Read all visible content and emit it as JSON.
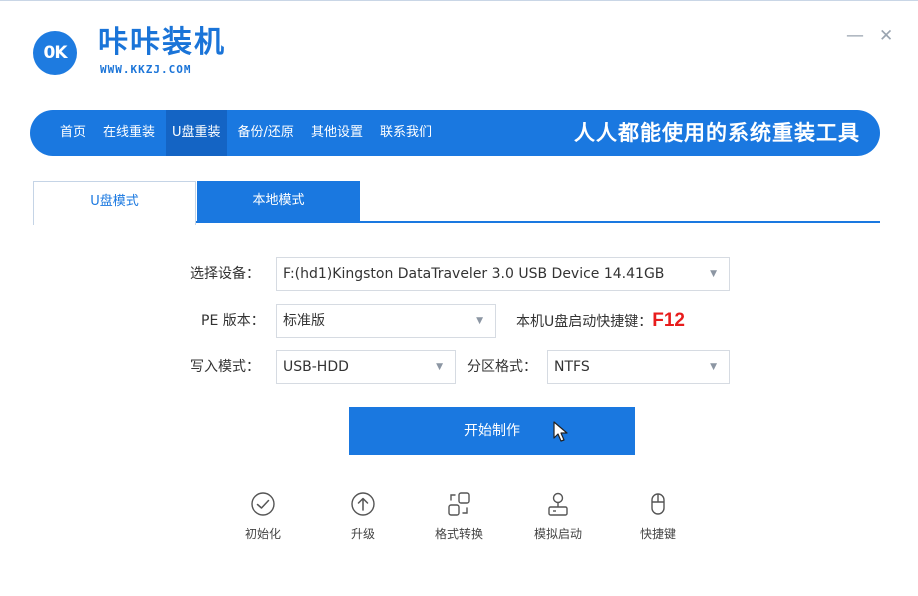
{
  "app": {
    "logo_badge": "0K",
    "title": "咔咔装机",
    "url": "WWW.KKZJ.COM",
    "minimize": "—",
    "close": "✕"
  },
  "nav": {
    "items": [
      {
        "label": "首页"
      },
      {
        "label": "在线重装"
      },
      {
        "label": "U盘重装"
      },
      {
        "label": "备份/还原"
      },
      {
        "label": "其他设置"
      },
      {
        "label": "联系我们"
      }
    ],
    "active_index": 2,
    "slogan": "人人都能使用的系统重装工具"
  },
  "tabs": [
    {
      "label": "U盘模式"
    },
    {
      "label": "本地模式"
    }
  ],
  "form": {
    "device_label": "选择设备：",
    "device_value": "F:(hd1)Kingston DataTraveler 3.0 USB Device 14.41GB",
    "pe_label": "PE 版本：",
    "pe_value": "标准版",
    "hotkey_label": "本机U盘启动快捷键：",
    "hotkey_value": "F12",
    "write_label": "写入模式：",
    "write_value": "USB-HDD",
    "partition_label": "分区格式：",
    "partition_value": "NTFS",
    "dropdown_arrow": "▼",
    "start_button": "开始制作"
  },
  "tools": [
    {
      "label": "初始化",
      "icon": "check-circle-icon"
    },
    {
      "label": "升级",
      "icon": "arrow-up-circle-icon"
    },
    {
      "label": "格式转换",
      "icon": "convert-icon"
    },
    {
      "label": "模拟启动",
      "icon": "boot-simulate-icon"
    },
    {
      "label": "快捷键",
      "icon": "mouse-icon"
    }
  ],
  "colors": {
    "primary": "#1a78e0",
    "nav_active": "#1464c4",
    "hotkey": "#e81c1c"
  }
}
